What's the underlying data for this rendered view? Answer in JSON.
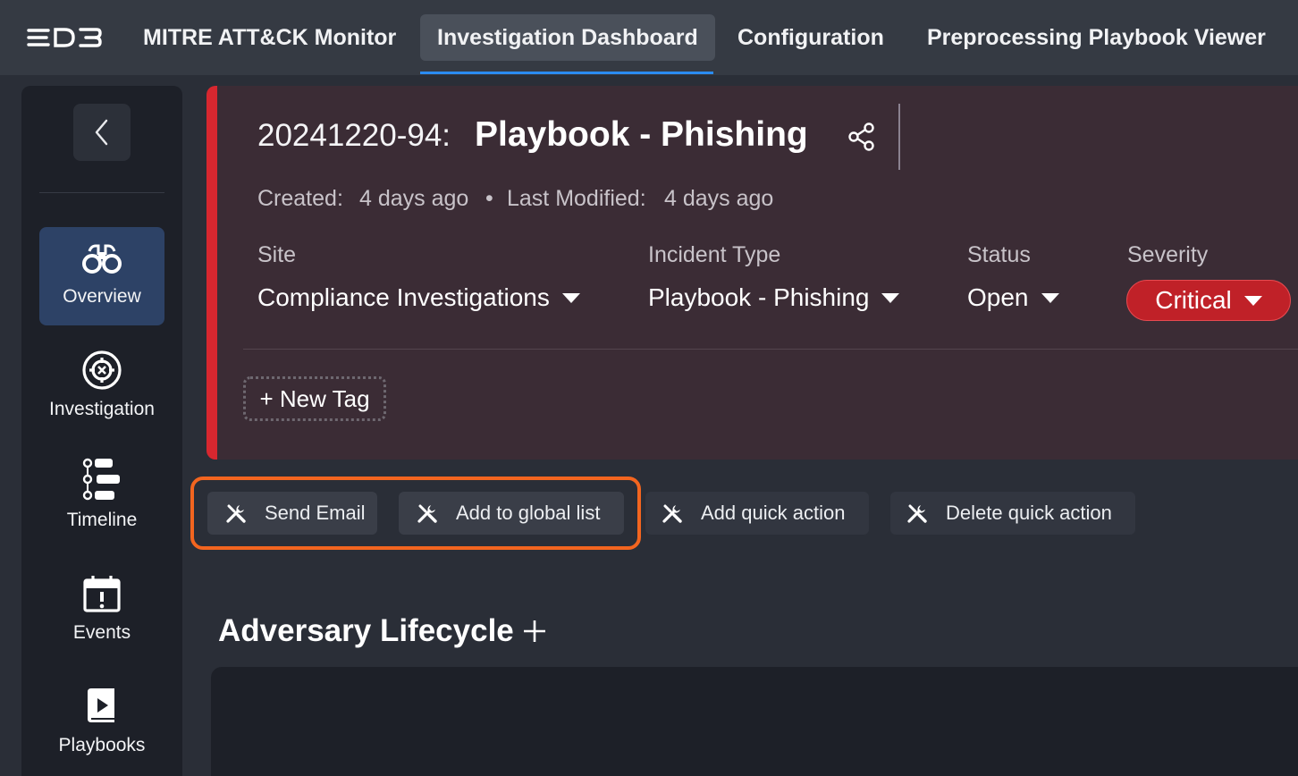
{
  "nav": {
    "logo_text": "D3",
    "tabs": [
      {
        "label": "MITRE ATT&CK Monitor"
      },
      {
        "label": "Investigation Dashboard",
        "active": true
      },
      {
        "label": "Configuration"
      },
      {
        "label": "Preprocessing Playbook Viewer"
      }
    ]
  },
  "sidebar": {
    "collapse_icon": "chevron-left-icon",
    "items": [
      {
        "label": "Overview",
        "icon": "binoculars-icon",
        "active": true
      },
      {
        "label": "Investigation",
        "icon": "crosshair-icon"
      },
      {
        "label": "Timeline",
        "icon": "timeline-icon"
      },
      {
        "label": "Events",
        "icon": "calendar-alert-icon"
      },
      {
        "label": "Playbooks",
        "icon": "playbook-icon"
      }
    ]
  },
  "incident": {
    "id": "20241220-94:",
    "title": "Playbook - Phishing",
    "created_label": "Created:",
    "created_value": "4 days ago",
    "separator": "•",
    "modified_label": "Last Modified:",
    "modified_value": "4 days ago",
    "fields": {
      "site": {
        "label": "Site",
        "value": "Compliance Investigations"
      },
      "incident_type": {
        "label": "Incident Type",
        "value": "Playbook - Phishing"
      },
      "status": {
        "label": "Status",
        "value": "Open"
      },
      "severity": {
        "label": "Severity",
        "value": "Critical"
      }
    },
    "new_tag_label": "+ New Tag",
    "accent_color": "#d7272f",
    "severity_color": "#c02128"
  },
  "quick_actions": {
    "items": [
      {
        "label": "Send Email",
        "icon": "wrench-icon"
      },
      {
        "label": "Add to global list",
        "icon": "wrench-icon"
      },
      {
        "label": "Add quick action",
        "icon": "wrench-icon"
      },
      {
        "label": "Delete quick action",
        "icon": "wrench-icon"
      }
    ],
    "highlight_color": "#f3651f"
  },
  "adversary": {
    "title": "Adversary Lifecycle"
  }
}
